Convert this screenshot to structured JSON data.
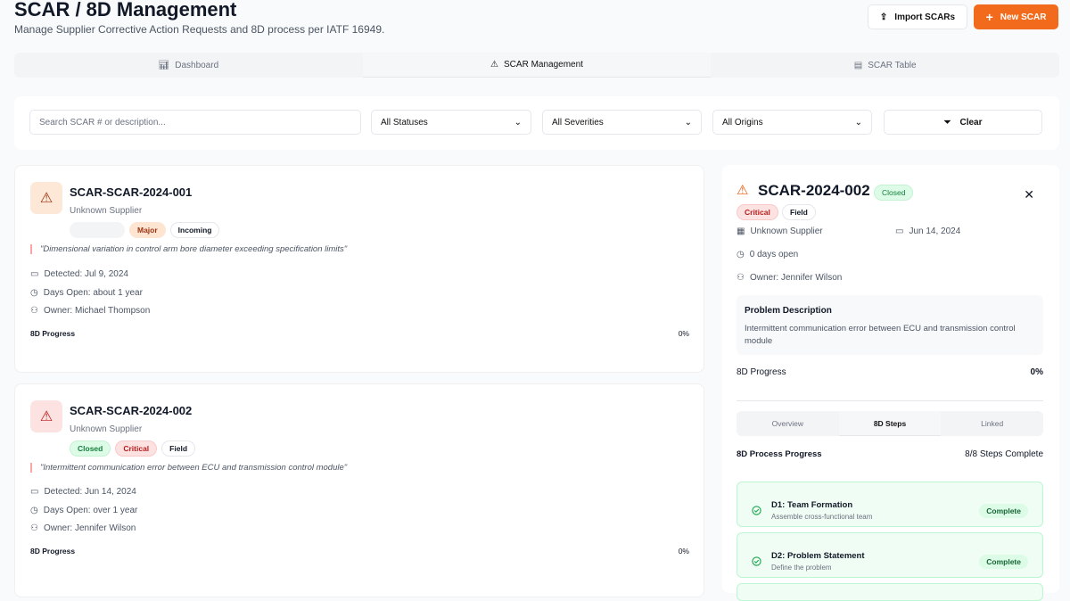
{
  "header": {
    "title": "SCAR / 8D Management",
    "subtitle": "Manage Supplier Corrective Action Requests and 8D process per IATF 16949.",
    "import_label": "Import SCARs",
    "new_label": "New SCAR"
  },
  "tabs": [
    {
      "label": "Dashboard"
    },
    {
      "label": "SCAR Management"
    },
    {
      "label": "SCAR Table"
    }
  ],
  "filters": {
    "search_placeholder": "Search SCAR # or description...",
    "status": "All Statuses",
    "severity": "All Severities",
    "origin": "All Origins",
    "clear": "Clear"
  },
  "cards": [
    {
      "title": "SCAR-SCAR-2024-001",
      "supplier": "Unknown Supplier",
      "badges": [
        "",
        "Major",
        "Incoming"
      ],
      "description": "\"Dimensional variation in control arm bore diameter exceeding specification limits\"",
      "detected": "Detected: Jul 9, 2024",
      "days_open": "Days Open: about 1 year",
      "owner": "Owner: Michael Thompson",
      "progress_label": "8D Progress",
      "progress": "0%"
    },
    {
      "title": "SCAR-SCAR-2024-002",
      "supplier": "Unknown Supplier",
      "badges": [
        "Closed",
        "Critical",
        "Field"
      ],
      "description": "\"Intermittent communication error between ECU and transmission control module\"",
      "detected": "Detected: Jun 14, 2024",
      "days_open": "Days Open: over 1 year",
      "owner": "Owner: Jennifer Wilson",
      "progress_label": "8D Progress",
      "progress": "0%"
    }
  ],
  "detail": {
    "title": "SCAR-2024-002",
    "status": "Closed",
    "severity": "Critical",
    "origin": "Field",
    "supplier": "Unknown Supplier",
    "date": "Jun 14, 2024",
    "days_open": "0 days open",
    "owner": "Owner: Jennifer Wilson",
    "problem_heading": "Problem Description",
    "problem_text": "Intermittent communication error between ECU and transmission control module",
    "progress_label": "8D Progress",
    "progress": "0%",
    "tabs": [
      "Overview",
      "8D Steps",
      "Linked"
    ],
    "steps_heading": "8D Process Progress",
    "steps_count": "8/8 Steps Complete",
    "steps": [
      {
        "title": "D1: Team Formation",
        "desc": "Assemble cross-functional team",
        "status": "Complete"
      },
      {
        "title": "D2: Problem Statement",
        "desc": "Define the problem",
        "status": "Complete"
      }
    ]
  },
  "colors": {
    "accent": "#f26b1d",
    "success": "#16a34a",
    "danger": "#dc2626"
  }
}
